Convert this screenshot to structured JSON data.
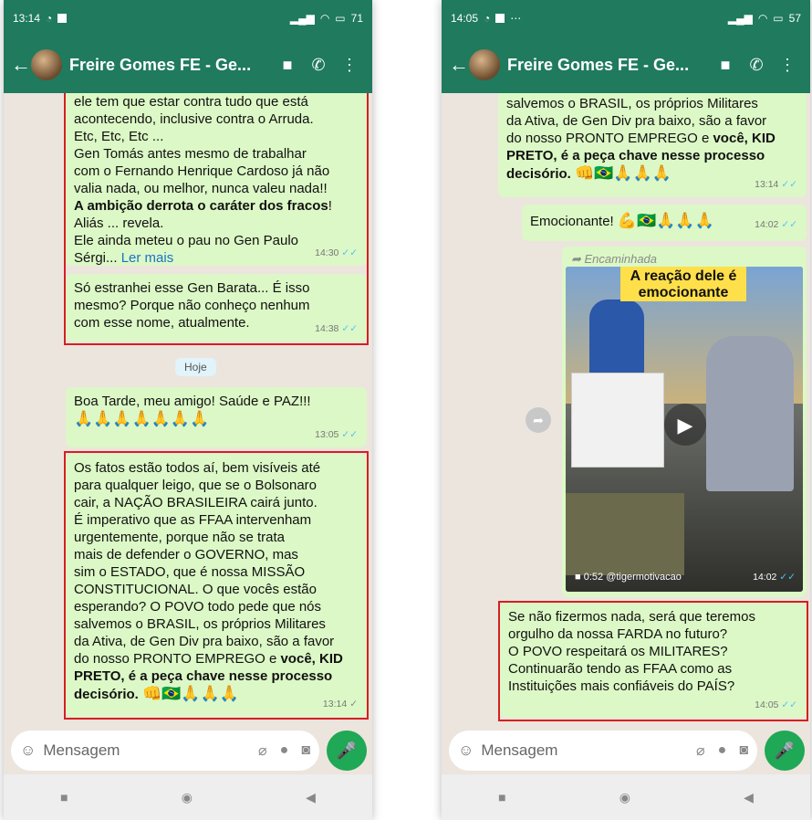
{
  "left": {
    "status_time": "13:14",
    "battery": "71",
    "chat_title": "Freire Gomes FE - Ge...",
    "msg1": {
      "l1": "ele tem que estar contra tudo que está",
      "l2": "acontecendo, inclusive contra o Arruda.",
      "l3": "Etc, Etc, Etc ...",
      "l4": "Gen Tomás  antes mesmo de trabalhar",
      "l5": "com o Fernando Henrique Cardoso já não",
      "l6": "valia nada, ou melhor, nunca valeu nada!!",
      "l7_bold": "A ambição derrota o caráter dos fracos",
      "l7_tail": "!",
      "l8": "Aliás ... revela.",
      "l9": " Ele ainda meteu o pau no Gen Paulo",
      "l10": "Sérgi...",
      "more": "Ler mais",
      "time": "14:30"
    },
    "msg2": {
      "l1": "Só estranhei esse Gen Barata... É isso",
      "l2": "mesmo? Porque não conheço nenhum",
      "l3": "com esse nome, atualmente.",
      "time": "14:38"
    },
    "date_chip": "Hoje",
    "msg3": {
      "l1": "Boa Tarde,  meu amigo!  Saúde e PAZ!!!",
      "emojis": "🙏🙏🙏🙏🙏🙏🙏",
      "time": "13:05"
    },
    "msg4": {
      "l1": "Os fatos estão todos aí, bem visíveis até",
      "l2": "para qualquer leigo, que se o Bolsonaro",
      "l3": "cair, a NAÇÃO BRASILEIRA cairá junto.",
      "l4": "É imperativo que as FFAA intervenham",
      "l5": "urgentemente, porque não se trata",
      "l6": "mais de defender o GOVERNO, mas",
      "l7": "sim o ESTADO, que é nossa MISSÃO",
      "l8": "CONSTITUCIONAL. O que vocês estão",
      "l9": "esperando? O POVO todo pede que nós",
      "l10": "salvemos o BRASIL, os próprios Militares",
      "l11": "da Ativa, de Gen Div pra baixo, são a favor",
      "l12_plain": "do nosso PRONTO EMPREGO e ",
      "l12_bold": "você, KID",
      "l13_bold": "PRETO, é a peça chave nesse processo",
      "l14_bold": "decisório.",
      "emojis": "👊🇧🇷🙏🙏🙏",
      "time": "13:14"
    },
    "input_placeholder": "Mensagem"
  },
  "right": {
    "status_time": "14:05",
    "battery": "57",
    "chat_title": "Freire Gomes FE - Ge...",
    "msg1": {
      "l1": "salvemos o BRASIL, os próprios Militares",
      "l2": "da Ativa, de Gen Div pra baixo, são a favor",
      "l3_plain": "do nosso PRONTO EMPREGO e ",
      "l3_bold": "você, KID",
      "l4_bold": "PRETO, é a peça chave nesse processo",
      "l5_bold": "decisório.",
      "emojis": "👊🇧🇷🙏🙏🙏",
      "time": "13:14"
    },
    "msg2": {
      "text": "Emocionante!",
      "emojis": "💪🇧🇷🙏🙏🙏",
      "time": "14:02"
    },
    "msg3": {
      "forwarded": "Encaminhada",
      "video_title_1": "A reação dele é",
      "video_title_2": "emocionante",
      "duration": "0:52",
      "watermark": "@tigermotivacao",
      "time": "14:02"
    },
    "msg4": {
      "l1": "Se não fizermos nada, será que teremos",
      "l2": "orgulho da nossa FARDA no futuro?",
      "l3": "O POVO respeitará os MILITARES?",
      "l4": "Continuarão tendo as FFAA como as",
      "l5": "Instituições mais confiáveis do PAÍS?",
      "time": "14:05"
    },
    "input_placeholder": "Mensagem"
  },
  "colors": {
    "header": "#1f7a5e",
    "bubble": "#dcf8c6",
    "highlight": "#d42020",
    "mic": "#1fa855"
  }
}
